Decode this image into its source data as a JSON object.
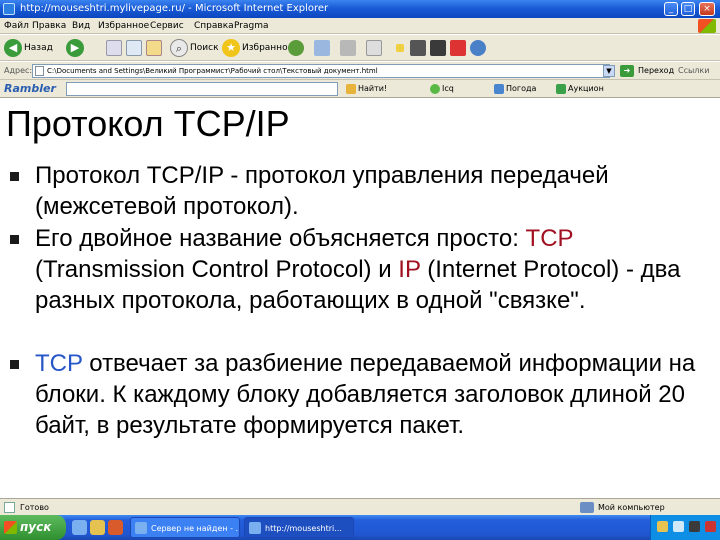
{
  "window": {
    "title": "http://mouseshtri.mylivepage.ru/ - Microsoft Internet Explorer",
    "minimize": "_",
    "maximize": "□",
    "close": "×"
  },
  "menu": [
    "Файл",
    "Правка",
    "Вид",
    "Избранное",
    "Сервис",
    "Справка",
    "Pragma"
  ],
  "toolbar": {
    "back": "Назад",
    "search": "Поиск",
    "favorites": "Избранное"
  },
  "address": {
    "label": "Адрес:",
    "value": "C:\\Documents and Settings\\Великий Программист\\Рабочий стол\\Текстовый документ.html",
    "go": "Переход",
    "links": "Ссылки"
  },
  "rambler": {
    "brand": "Rambler",
    "find": "Найти!",
    "icq": "Icq",
    "items": [
      "Погода",
      "Аукцион"
    ]
  },
  "slide": {
    "title": "Протокол TCP/IP",
    "bullets": [
      {
        "parts": [
          {
            "text": "Протокол TCP/IP - протокол управления передачей (межсетевой протокол).",
            "style": ""
          }
        ]
      },
      {
        "parts": [
          {
            "text": "Его двойное название объясняется просто: ",
            "style": ""
          },
          {
            "text": "TCP",
            "style": "hl"
          },
          {
            "text": " (Transmission Control Protocol) и ",
            "style": ""
          },
          {
            "text": "IP",
            "style": "hl"
          },
          {
            "text": " (Internet Protocol) - два разных протокола, работающих в одной \"связке\".",
            "style": ""
          }
        ]
      },
      {
        "parts": [
          {
            "text": "TCP",
            "style": "hl-blue"
          },
          {
            "text": " отвечает за разбиение передаваемой информации на блоки. К каждому блоку добавляется заголовок длиной 20 байт, в результате формируется пакет.",
            "style": ""
          }
        ]
      }
    ]
  },
  "status": {
    "text": "Готово",
    "zone": "Мой компьютер"
  },
  "taskbar": {
    "start": "пуск",
    "tasks": [
      "Сервер не найден - ...",
      "http://mouseshtri..."
    ],
    "clock": ""
  },
  "colors": {
    "highlight_red": "#a01020",
    "highlight_blue": "#2656c8",
    "titlebar": "#1a5cd6",
    "taskbar": "#245edb"
  }
}
